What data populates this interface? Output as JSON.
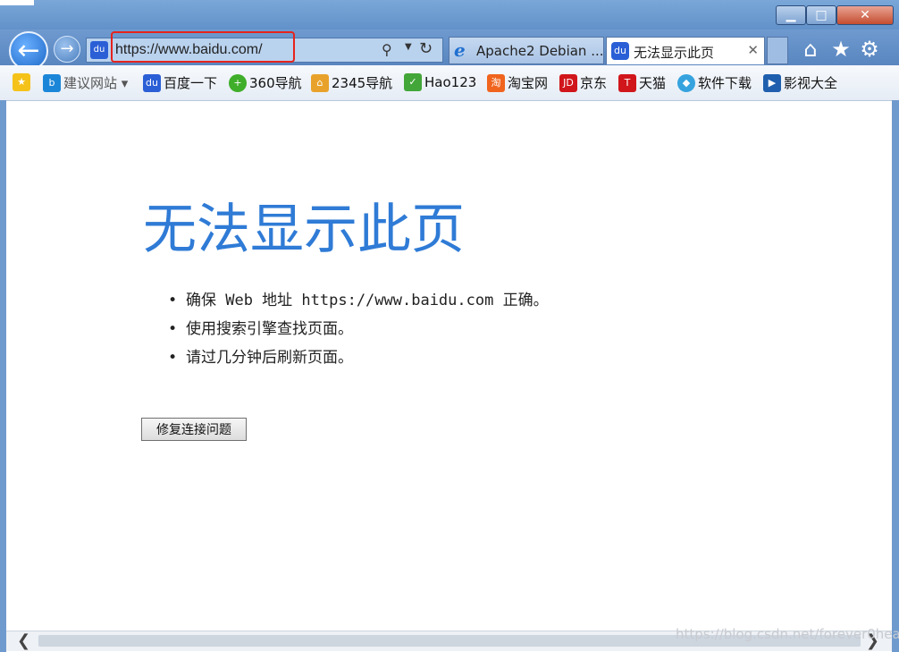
{
  "window": {
    "min_glyph": "▁",
    "max_glyph": "□",
    "close_glyph": "✕"
  },
  "nav": {
    "back_glyph": "←",
    "forward_glyph": "→"
  },
  "address": {
    "url": "https://www.baidu.com/",
    "site_icon": "du"
  },
  "tabs": [
    {
      "label": "Apache2 Debian ...",
      "icon": "ie-icon"
    },
    {
      "label": "无法显示此页",
      "icon": "baidu-icon",
      "close": "✕"
    }
  ],
  "toolbar": {
    "home": "⌂",
    "favorites": "★",
    "settings": "⚙"
  },
  "favorites": [
    {
      "label": "建议网站 ▾"
    },
    {
      "label": "百度一下"
    },
    {
      "label": "360导航"
    },
    {
      "label": "2345导航"
    },
    {
      "label": "Hao123"
    },
    {
      "label": "淘宝网"
    },
    {
      "label": "京东"
    },
    {
      "label": "天猫"
    },
    {
      "label": "软件下载"
    },
    {
      "label": "影视大全"
    }
  ],
  "page": {
    "title": "无法显示此页",
    "bullets": [
      "确保 Web 地址 https://www.baidu.com 正确。",
      "使用搜索引擎查找页面。",
      "请过几分钟后刷新页面。"
    ],
    "fix_button": "修复连接问题"
  },
  "watermark": "https://blog.csdn.net/forever0heart",
  "colors": {
    "title_blue": "#2f7bd6",
    "chrome_blue": "#5f8fc8",
    "highlight_red": "#e6231c"
  }
}
